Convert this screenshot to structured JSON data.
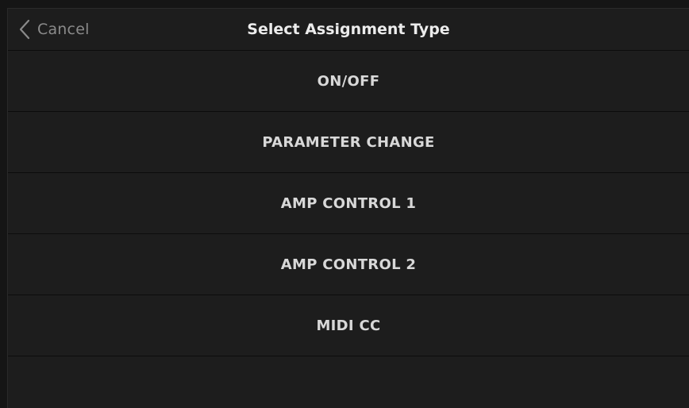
{
  "header": {
    "cancel_label": "Cancel",
    "title": "Select Assignment Type"
  },
  "options": [
    {
      "label": "ON/OFF"
    },
    {
      "label": "PARAMETER CHANGE"
    },
    {
      "label": "AMP CONTROL 1"
    },
    {
      "label": "AMP CONTROL 2"
    },
    {
      "label": "MIDI CC"
    }
  ],
  "colors": {
    "background": "#1d1d1d",
    "text": "#d8d8d8",
    "muted_text": "#8a8a8a"
  }
}
